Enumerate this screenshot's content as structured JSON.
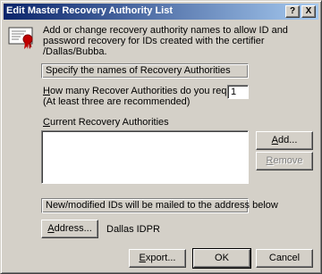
{
  "window": {
    "title": "Edit Master Recovery Authority List"
  },
  "caption_buttons": {
    "help": "?",
    "close": "X"
  },
  "intro": {
    "line1": "Add or change recovery authority names to allow ID and",
    "line2": "password recovery for IDs created with the certifier",
    "line3": "/Dallas/Bubba."
  },
  "authorities_header": "Specify the names of Recovery Authorities",
  "count": {
    "label_hotkey": "H",
    "label_rest": "ow many Recover Authorities do you require?",
    "hint": "(At least three are recommended)",
    "value": "1"
  },
  "current_list": {
    "label_hotkey": "C",
    "label_rest": "urrent Recovery Authorities",
    "items": []
  },
  "side_buttons": {
    "add_hotkey": "A",
    "add_rest": "dd...",
    "remove_hotkey": "R",
    "remove_rest": "emove"
  },
  "mail_header": "New/modified IDs will be mailed to the address below",
  "address": {
    "button_hotkey": "A",
    "button_rest": "ddress...",
    "value": "Dallas IDPR"
  },
  "bottom_buttons": {
    "export_hotkey": "E",
    "export_rest": "xport...",
    "ok": "OK",
    "cancel": "Cancel"
  }
}
